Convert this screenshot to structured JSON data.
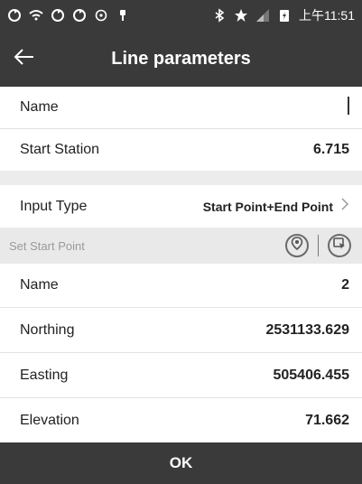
{
  "status_bar": {
    "icons_left": [
      "sync-icon",
      "wifi-off-icon",
      "sync-icon",
      "sync-icon",
      "gps-icon",
      "pin-icon"
    ],
    "icons_right": [
      "bluetooth-icon",
      "star-icon",
      "signal-icon",
      "battery-charging-icon"
    ],
    "time": "上午11:51"
  },
  "app_bar": {
    "back_icon": "arrow-left-icon",
    "title": "Line parameters"
  },
  "fields": {
    "name": {
      "label": "Name",
      "value": ""
    },
    "start_station": {
      "label": "Start Station",
      "value": "6.715"
    },
    "input_type": {
      "label": "Input Type",
      "value": "Start Point+End Point"
    }
  },
  "start_point": {
    "header": "Set Start Point",
    "name": {
      "label": "Name",
      "value": "2"
    },
    "northing": {
      "label": "Northing",
      "value": "2531133.629"
    },
    "easting": {
      "label": "Easting",
      "value": "505406.455"
    },
    "elevation": {
      "label": "Elevation",
      "value": "71.662"
    }
  },
  "actions": {
    "ok_label": "OK"
  },
  "colors": {
    "bar_background": "#3a3a3a",
    "section_background": "#e9e9e9",
    "divider": "#e3e3e3"
  }
}
